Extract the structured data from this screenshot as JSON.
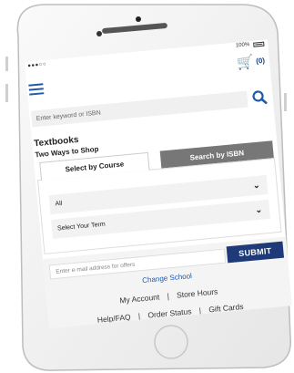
{
  "status_bar": {
    "signal": "●●●○○",
    "battery": "100%"
  },
  "header": {
    "cart_count": "(0)"
  },
  "search": {
    "placeholder": "Enter keyword or ISBN"
  },
  "textbooks": {
    "title": "Textbooks",
    "subtitle": "Two Ways to Shop",
    "tabs": [
      {
        "label": "Select by Course",
        "active": true
      },
      {
        "label": "Search by ISBN",
        "active": false
      }
    ],
    "select_school": "All",
    "select_term": "Select Your Term"
  },
  "footer": {
    "email_placeholder": "Enter e-mail address for offers",
    "submit_label": "SUBMIT",
    "change_school": "Change School",
    "links_row1": [
      "My Account",
      "Store Hours"
    ],
    "links_row2": [
      "Help/FAQ",
      "Order Status",
      "Gift Cards"
    ]
  }
}
